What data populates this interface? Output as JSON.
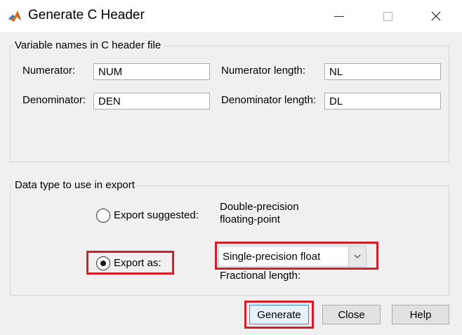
{
  "window": {
    "title": "Generate C Header"
  },
  "variables_group": {
    "title": "Variable names in C header file",
    "numerator_label": "Numerator:",
    "numerator_value": "NUM",
    "numerator_length_label": "Numerator length:",
    "numerator_length_value": "NL",
    "denominator_label": "Denominator:",
    "denominator_value": "DEN",
    "denominator_length_label": "Denominator length:",
    "denominator_length_value": "DL"
  },
  "datatype_group": {
    "title": "Data type to use in export",
    "export_suggested_label": "Export suggested:",
    "suggested_type_line1": "Double-precision",
    "suggested_type_line2": "floating-point",
    "export_as_label": "Export as:",
    "export_as_selected": true,
    "export_as_value": "Single-precision float",
    "fractional_length_label": "Fractional length:"
  },
  "buttons": {
    "generate": "Generate",
    "close": "Close",
    "help": "Help"
  },
  "colors": {
    "highlight": "#d21f2b",
    "accent": "#3c89d0"
  }
}
